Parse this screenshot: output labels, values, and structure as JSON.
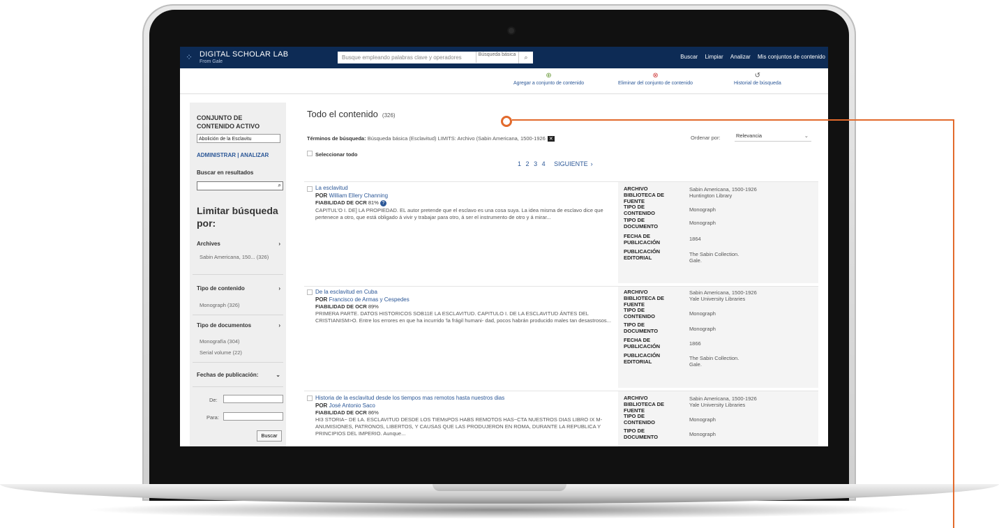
{
  "app": {
    "brand": "DIGITAL SCHOLAR LAB",
    "brand_sub": "From Gale",
    "search_placeholder": "Busque empleando palabras clave y operadores",
    "search_type": "Búsqueda básica",
    "nav": [
      "Buscar",
      "Limpiar",
      "Analizar",
      "Mis conjuntos de contenido"
    ]
  },
  "actions": {
    "add": "Agregar a conjunto de contenido",
    "remove": "Eliminar del conjunto de contenido",
    "history": "Historial de búsqueda"
  },
  "sidebar": {
    "title": "CONJUNTO DE CONTENIDO ACTIVO",
    "selected_set": "Abolición de la Esclavitu",
    "links": "ADMINISTRAR | ANALIZAR",
    "search_in_results": "Buscar en resultados",
    "limit": "Limitar búsqueda por:",
    "archives_label": "Archives",
    "archives_item": "Sabin Americana, 150... (326)",
    "content_type_label": "Tipo de contenido",
    "content_type_item": "Monograph (326)",
    "doc_type_label": "Tipo de documentos",
    "doc_type_items": [
      "Monografía (304)",
      "Serial volume (22)"
    ],
    "dates_label": "Fechas de publicación:",
    "from_label": "De:",
    "to_label": "Para:",
    "search_button": "Buscar"
  },
  "main": {
    "title": "Todo el contenido",
    "count": "(326)",
    "terms_label": "Términos de búsqueda:",
    "terms_value": "Búsqueda básica (Esclavitud) LIMITS: Archivo (Sabin Americana, 1500-1926",
    "order_label": "Ordenar por:",
    "order_value": "Relevancia",
    "select_all": "Seleccionar todo",
    "pages": [
      "1",
      "2",
      "3",
      "4"
    ],
    "next": "SIGUIENTE"
  },
  "meta_labels": {
    "archive": "ARCHIVO",
    "library": "BIBLIOTECA DE FUENTE",
    "content_type": "TIPO DE CONTENIDO",
    "doc_type": "TIPO DE DOCUMENTO",
    "pub_date": "FECHA DE PUBLICACIÓN",
    "publisher": "PUBLICACIÓN EDITORIAL"
  },
  "results": [
    {
      "title": "La esclavitud",
      "by": "POR",
      "author": "William Ellery Channing",
      "ocr_label": "FIABILIDAD DE OCR",
      "ocr": "81%",
      "snippet": "CAPITUL'O I. DE] LA PROPIEDAD. EL autor pretende que el esclavo es una cosa suya. La idea misma de esclavo dice que pertenece a otro, que está obligado á vivir y trabajar para otro, á ser el instrumento de otro y á mirar...",
      "archive": "Sabin Americana, 1500-1926",
      "library": "Huntington Library",
      "content_type": "Monograph",
      "doc_type": "Monograph",
      "pub_date": "1864",
      "publisher": "The Sabin Collection. Gale."
    },
    {
      "title": "De la esclavitud en Cuba",
      "by": "POR",
      "author": "Francisco de Armas y Cespedes",
      "ocr_label": "FIABILIDAD DE OCR",
      "ocr": "89%",
      "snippet": "PRIMERA PARTE. DATOS HISTORICOS SOB11E LA ESCLAVITUD. CAPITULO I. DE LA ESCLAVITUD ÁNTES DEL CRISTIANISM>O. Entre los errores en que ha incurrido 'la frágil humani- dad, pocos habrán producido males tan desastrosos...",
      "archive": "Sabin Americana, 1500-1926",
      "library": "Yale University Libraries",
      "content_type": "Monograph",
      "doc_type": "Monograph",
      "pub_date": "1866",
      "publisher": "The Sabin Collection. Gale."
    },
    {
      "title": "Historia de la esclavitud desde los tiempos mas remotos hasta nuestros dias",
      "by": "POR",
      "author": "José Antonio Saco",
      "ocr_label": "FIABILIDAD DE OCR",
      "ocr": "86%",
      "snippet": "HI3 STORIA~ DE LA. ESCLAVITUD DESDE LOS TIEMsPOS HABS REMOTOS HAS~CTA NUESTROS DIAS LIBRO IX M-ANUMISIONES, PATRONOS, LIBERTOS, Y CAUSAS QUE LAS PRODUJERON EN ROMA, DURANTE LA REPUBLICA Y PRINCIPIOS DEL IMPERIO. Aunque...",
      "archive": "Sabin Americana, 1500-1926",
      "library": "Yale University Libraries",
      "content_type": "Monograph",
      "doc_type": "Monograph"
    }
  ]
}
